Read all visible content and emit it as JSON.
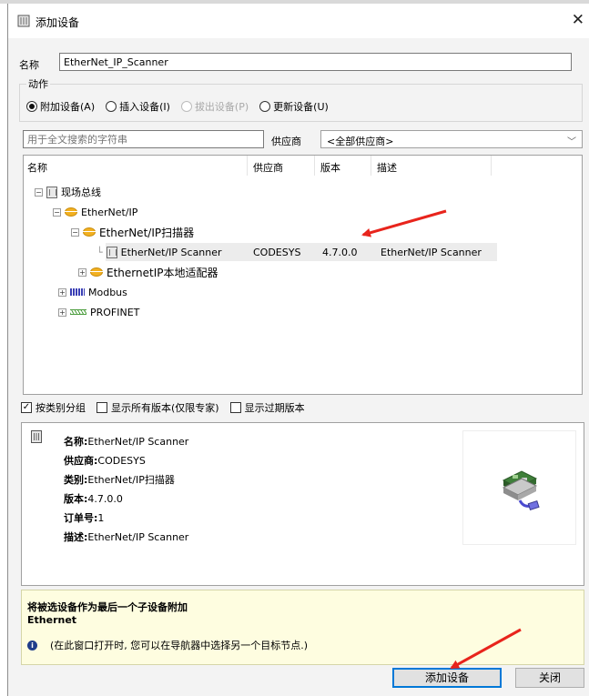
{
  "window": {
    "title": "添加设备"
  },
  "name_field": {
    "label": "名称",
    "value": "EtherNet_IP_Scanner"
  },
  "action_group": {
    "legend": "动作",
    "options": [
      {
        "label": "附加设备(A)",
        "selected": true,
        "enabled": true
      },
      {
        "label": "插入设备(I)",
        "selected": false,
        "enabled": true
      },
      {
        "label": "拔出设备(P)",
        "selected": false,
        "enabled": false
      },
      {
        "label": "更新设备(U)",
        "selected": false,
        "enabled": true
      }
    ]
  },
  "search": {
    "placeholder": "用于全文搜索的字符串"
  },
  "vendor": {
    "label": "供应商",
    "selected": "<全部供应商>"
  },
  "tree": {
    "columns": [
      "名称",
      "供应商",
      "版本",
      "描述"
    ],
    "items": [
      {
        "label": "现场总线",
        "icon": "device-icon",
        "expander": "−"
      },
      {
        "label": "EtherNet/IP",
        "icon": "ethernet-ip-icon",
        "expander": "−"
      },
      {
        "label": "EtherNet/IP扫描器",
        "icon": "ethernet-ip-icon",
        "expander": "−"
      },
      {
        "label": "EtherNet/IP Scanner",
        "icon": "device-icon",
        "vendor": "CODESYS",
        "version": "4.7.0.0",
        "description": "EtherNet/IP Scanner",
        "selected": true
      },
      {
        "label": "EthernetIP本地适配器",
        "icon": "ethernet-ip-icon",
        "expander": "+"
      },
      {
        "label": "Modbus",
        "icon": "modbus-icon",
        "expander": "+"
      },
      {
        "label": "PROFINET",
        "icon": "profinet-icon",
        "expander": "+"
      }
    ]
  },
  "options": [
    {
      "label": "按类别分组",
      "checked": true
    },
    {
      "label": "显示所有版本(仅限专家)",
      "checked": false
    },
    {
      "label": "显示过期版本",
      "checked": false
    }
  ],
  "info": {
    "name_key": "名称:",
    "name_val": "EtherNet/IP Scanner",
    "vendor_key": "供应商:",
    "vendor_val": "CODESYS",
    "category_key": "类别:",
    "category_val": "EtherNet/IP扫描器",
    "version_key": "版本:",
    "version_val": "4.7.0.0",
    "order_key": "订单号:",
    "order_val": "1",
    "desc_key": "描述:",
    "desc_val": "EtherNet/IP Scanner"
  },
  "help": {
    "title": "将被选设备作为最后一个子设备附加",
    "subtitle": "Ethernet",
    "tip": "(在此窗口打开时, 您可以在导航器中选择另一个目标节点.)"
  },
  "buttons": {
    "add": "添加设备",
    "close": "关闭"
  },
  "colors": {
    "annotation_arrow": "#e8241c",
    "help_background": "#fefde0",
    "selected_row": "#ececec"
  }
}
